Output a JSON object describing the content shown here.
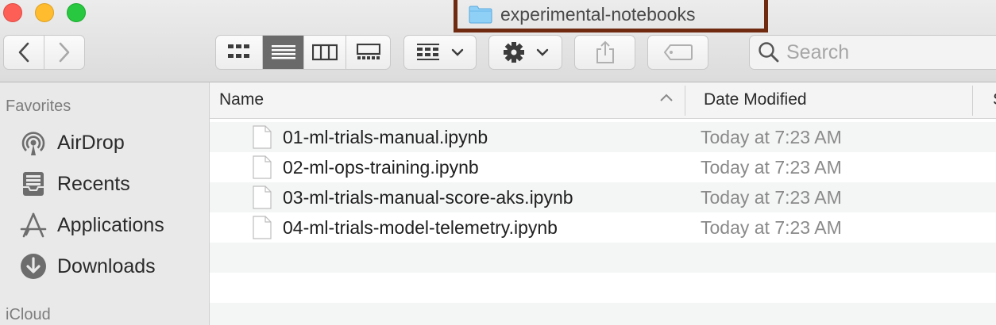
{
  "window": {
    "title": "experimental-notebooks"
  },
  "toolbar": {
    "back_icon": "chevron-left-icon",
    "forward_icon": "chevron-right-icon",
    "view_modes": [
      "icon-view",
      "list-view",
      "column-view",
      "gallery-view"
    ],
    "active_view": "list-view",
    "group_icon": "group-grid-icon",
    "action_icon": "gear-icon",
    "share_icon": "share-icon",
    "tag_icon": "tag-icon",
    "search_placeholder": "Search"
  },
  "sidebar": {
    "favorites_label": "Favorites",
    "items": [
      {
        "label": "AirDrop",
        "icon": "airdrop-icon"
      },
      {
        "label": "Recents",
        "icon": "recents-icon"
      },
      {
        "label": "Applications",
        "icon": "applications-icon"
      },
      {
        "label": "Downloads",
        "icon": "downloads-icon"
      }
    ],
    "icloud_label": "iCloud"
  },
  "list": {
    "columns": {
      "name": "Name",
      "date": "Date Modified",
      "size": "S"
    },
    "files": [
      {
        "name": "01-ml-trials-manual.ipynb",
        "date": "Today at 7:23 AM"
      },
      {
        "name": "02-ml-ops-training.ipynb",
        "date": "Today at 7:23 AM"
      },
      {
        "name": "03-ml-trials-manual-score-aks.ipynb",
        "date": "Today at 7:23 AM"
      },
      {
        "name": "04-ml-trials-model-telemetry.ipynb",
        "date": "Today at 7:23 AM"
      }
    ]
  },
  "colors": {
    "close": "#fd5f57",
    "minimize": "#febc2e",
    "maximize": "#28c840",
    "title_highlight": "#6f2a10",
    "folder": "#7fc4f2"
  }
}
